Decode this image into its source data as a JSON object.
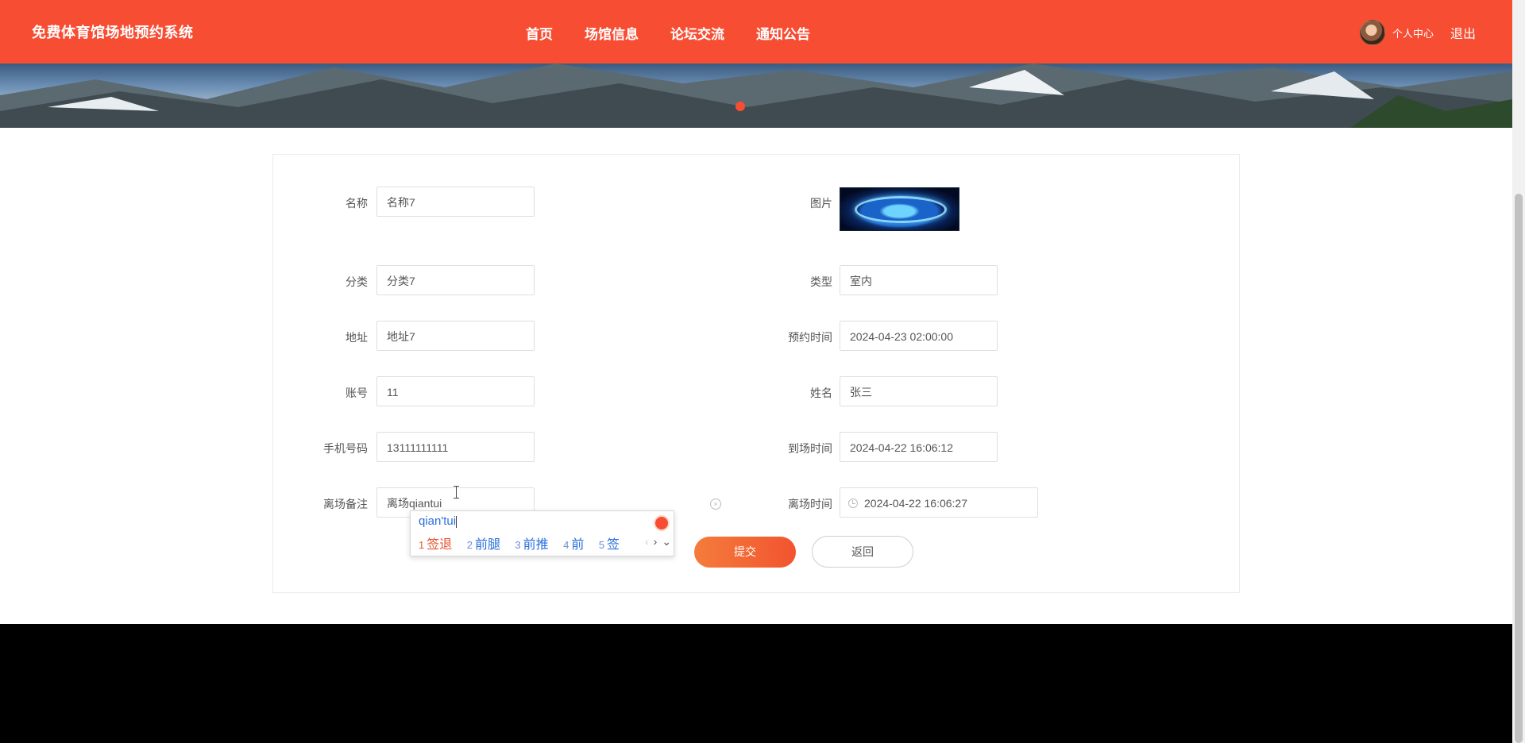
{
  "header": {
    "brand": "免费体育馆场地预约系统",
    "nav": [
      "首页",
      "场馆信息",
      "论坛交流",
      "通知公告"
    ],
    "user_center": "个人中心",
    "logout": "退出",
    "accent_color": "#f74d33"
  },
  "form": {
    "fields_left": [
      {
        "label": "名称",
        "value": "名称7"
      },
      {
        "label": "分类",
        "value": "分类7"
      },
      {
        "label": "地址",
        "value": "地址7"
      },
      {
        "label": "账号",
        "value": "11"
      },
      {
        "label": "手机号码",
        "value": "13111111111"
      },
      {
        "label": "离场备注",
        "value": "离场qiantui"
      }
    ],
    "fields_right": [
      {
        "label": "图片",
        "value": ""
      },
      {
        "label": "类型",
        "value": "室内"
      },
      {
        "label": "预约时间",
        "value": "2024-04-23 02:00:00"
      },
      {
        "label": "姓名",
        "value": "张三"
      },
      {
        "label": "到场时间",
        "value": "2024-04-22 16:06:12"
      },
      {
        "label": "离场时间",
        "value": "2024-04-22 16:06:27"
      }
    ],
    "submit_label": "提交",
    "back_label": "返回"
  },
  "ime": {
    "composition": "qian'tui",
    "candidates": [
      {
        "n": "1",
        "text": "签退"
      },
      {
        "n": "2",
        "text": "前腿"
      },
      {
        "n": "3",
        "text": "前推"
      },
      {
        "n": "4",
        "text": "前"
      },
      {
        "n": "5",
        "text": "签"
      }
    ]
  }
}
